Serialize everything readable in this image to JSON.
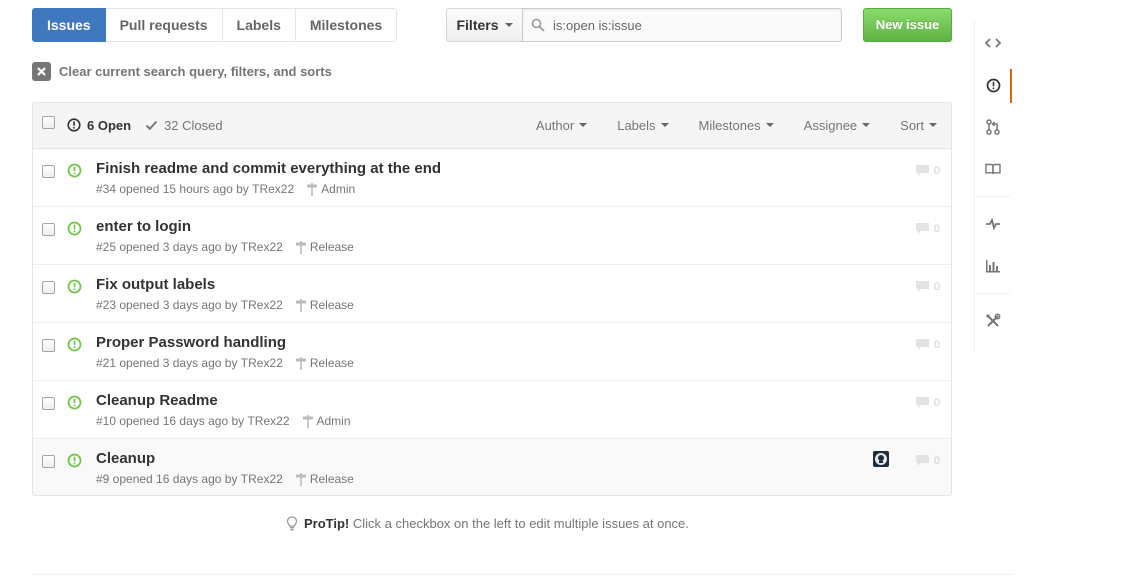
{
  "nav_tabs": {
    "issues": "Issues",
    "pull_requests": "Pull requests",
    "labels": "Labels",
    "milestones": "Milestones"
  },
  "filters": {
    "label": "Filters",
    "search_value": "is:open is:issue"
  },
  "new_issue_label": "New issue",
  "clear_query_label": "Clear current search query, filters, and sorts",
  "table_header": {
    "open_label": "6 Open",
    "closed_label": "32 Closed",
    "menus": {
      "author": "Author",
      "labels": "Labels",
      "milestones": "Milestones",
      "assignee": "Assignee",
      "sort": "Sort"
    }
  },
  "issues": [
    {
      "title": "Finish readme and commit everything at the end",
      "meta": "#34 opened 15 hours ago by",
      "author": "TRex22",
      "milestone": "Admin",
      "comments": "0"
    },
    {
      "title": "enter to login",
      "meta": "#25 opened 3 days ago by",
      "author": "TRex22",
      "milestone": "Release",
      "comments": "0"
    },
    {
      "title": "Fix output labels",
      "meta": "#23 opened 3 days ago by",
      "author": "TRex22",
      "milestone": "Release",
      "comments": "0"
    },
    {
      "title": "Proper Password handling",
      "meta": "#21 opened 3 days ago by",
      "author": "TRex22",
      "milestone": "Release",
      "comments": "0"
    },
    {
      "title": "Cleanup Readme",
      "meta": "#10 opened 16 days ago by",
      "author": "TRex22",
      "milestone": "Admin",
      "comments": "0"
    },
    {
      "title": "Cleanup",
      "meta": "#9 opened 16 days ago by",
      "author": "TRex22",
      "milestone": "Release",
      "comments": "0"
    }
  ],
  "protip": {
    "strong": "ProTip!",
    "text": "Click a checkbox on the left to edit multiple issues at once."
  },
  "colors": {
    "tab_selected": "#4078c0",
    "new_issue_green": "#60b044",
    "open_issue_icon": "#6cc644",
    "sidebar_selected_accent": "#d26911"
  },
  "repo_nav_icons": [
    "code-icon",
    "issue-opened-icon",
    "git-pull-request-icon",
    "book-icon",
    "pulse-icon",
    "graph-icon",
    "tools-icon"
  ]
}
